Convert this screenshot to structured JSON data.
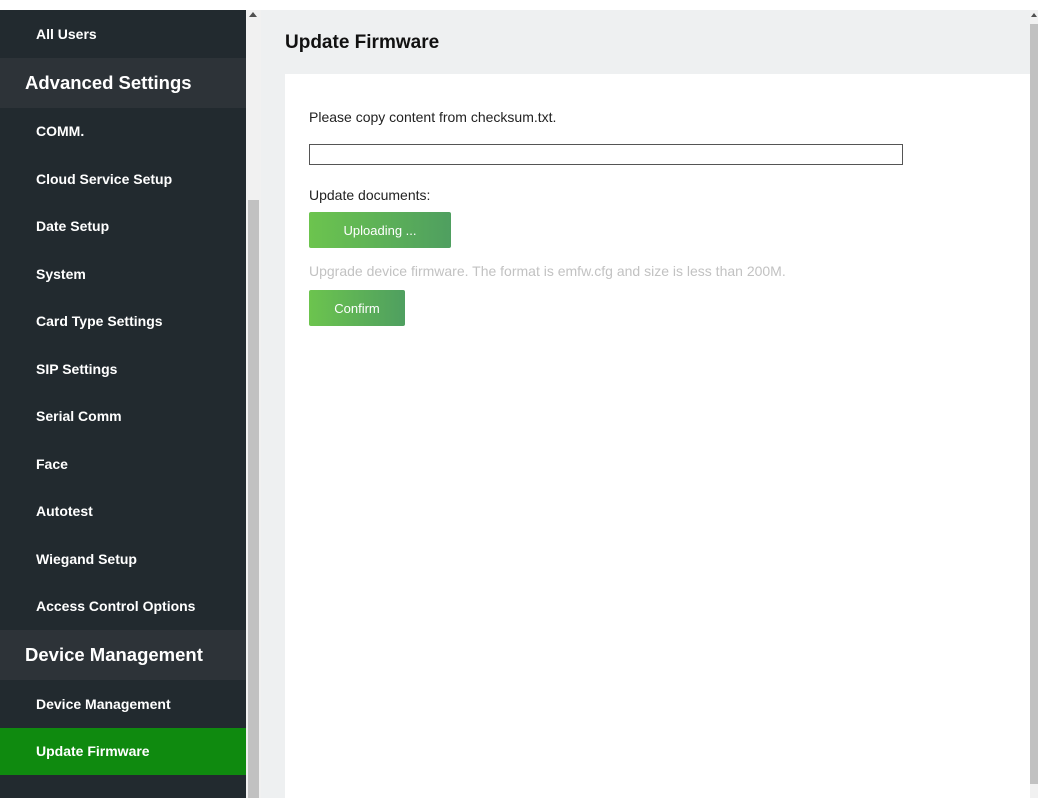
{
  "sidebar": {
    "items": [
      {
        "type": "item",
        "label": "All Users"
      },
      {
        "type": "group",
        "label": "Advanced Settings"
      },
      {
        "type": "item",
        "label": "COMM."
      },
      {
        "type": "item",
        "label": "Cloud Service Setup"
      },
      {
        "type": "item",
        "label": "Date Setup"
      },
      {
        "type": "item",
        "label": "System"
      },
      {
        "type": "item",
        "label": "Card Type Settings"
      },
      {
        "type": "item",
        "label": "SIP Settings"
      },
      {
        "type": "item",
        "label": "Serial Comm"
      },
      {
        "type": "item",
        "label": "Face"
      },
      {
        "type": "item",
        "label": "Autotest"
      },
      {
        "type": "item",
        "label": "Wiegand Setup"
      },
      {
        "type": "item",
        "label": "Access Control Options"
      },
      {
        "type": "group",
        "label": "Device Management"
      },
      {
        "type": "item",
        "label": "Device Management"
      },
      {
        "type": "item",
        "label": "Update Firmware",
        "active": true
      }
    ]
  },
  "main": {
    "title": "Update Firmware",
    "checksum_hint": "Please copy content from checksum.txt.",
    "checksum_value": "",
    "documents_label": "Update documents:",
    "upload_button": "Uploading ...",
    "format_note": "Upgrade device firmware. The format is emfw.cfg and size is less than 200M.",
    "confirm_button": "Confirm"
  },
  "colors": {
    "sidebar_bg": "#222a2f",
    "group_bg": "#2d3338",
    "active_bg": "#0f8a0f",
    "button_start": "#6cc44e",
    "button_end": "#4f9f60"
  }
}
